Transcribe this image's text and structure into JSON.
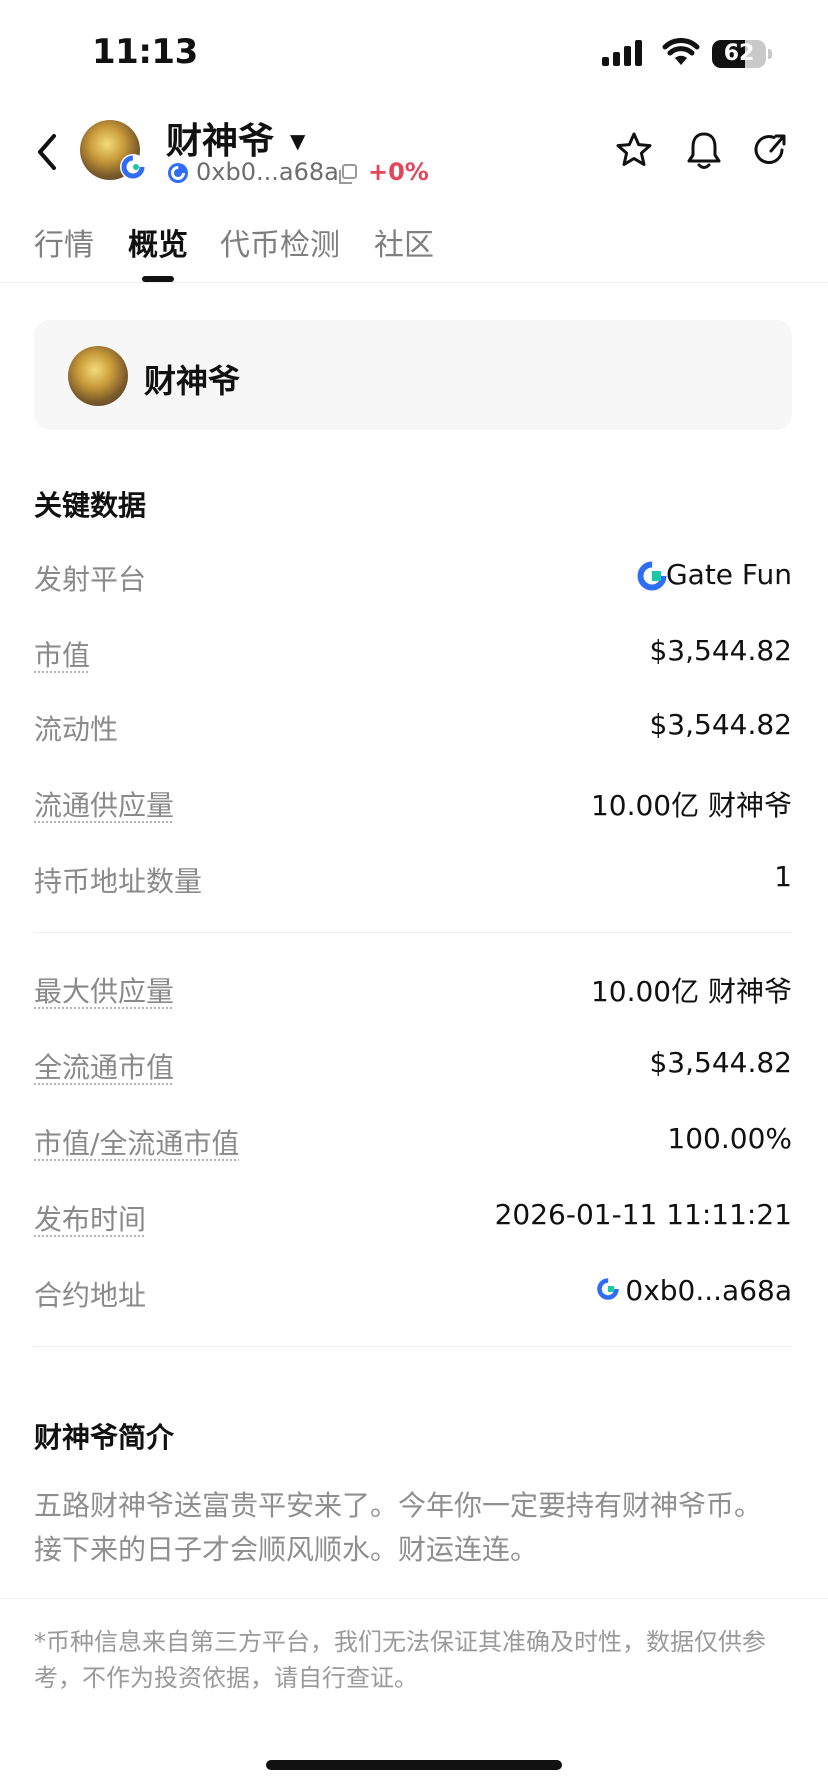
{
  "status_bar": {
    "time": "11:13",
    "battery": "62",
    "battery_level": 0.62
  },
  "header": {
    "token_name": "财神爷",
    "address_short": "0xb0...a68a",
    "change_pct": "+0%",
    "icons": [
      "back-icon",
      "star-icon",
      "bell-icon",
      "share-icon",
      "copy-icon"
    ]
  },
  "tabs": [
    {
      "label": "行情",
      "active": false
    },
    {
      "label": "概览",
      "active": true
    },
    {
      "label": "代币检测",
      "active": false
    },
    {
      "label": "社区",
      "active": false
    }
  ],
  "token_card": {
    "name": "财神爷"
  },
  "key_data": {
    "title": "关键数据",
    "rows": [
      {
        "label": "发射平台",
        "value": "Gate Fun"
      },
      {
        "label": "市值",
        "value": "$3,544.82"
      },
      {
        "label": "流动性",
        "value": "$3,544.82"
      },
      {
        "label": "流通供应量",
        "value": "10.00亿 财神爷"
      },
      {
        "label": "持币地址数量",
        "value": "1"
      },
      {
        "label": "最大供应量",
        "value": "10.00亿 财神爷"
      },
      {
        "label": "全流通市值",
        "value": "$3,544.82"
      },
      {
        "label": "市值/全流通市值",
        "value": "100.00%"
      },
      {
        "label": "发布时间",
        "value": "2026-01-11 11:11:21"
      },
      {
        "label": "合约地址",
        "value": "0xb0...a68a"
      }
    ]
  },
  "intro": {
    "title": "财神爷简介",
    "text": "五路财神爷送富贵平安来了。今年你一定要持有财神爷币。接下来的日子才会顺风顺水。财运连连。"
  },
  "disclaimer": "*币种信息来自第三方平台，我们无法保证其准确及时性，数据仅供参考，不作为投资依据，请自行查证。",
  "colors": {
    "accent_blue": "#2f6df6",
    "accent_teal": "#17c9a6",
    "change_red": "#e5455b"
  }
}
